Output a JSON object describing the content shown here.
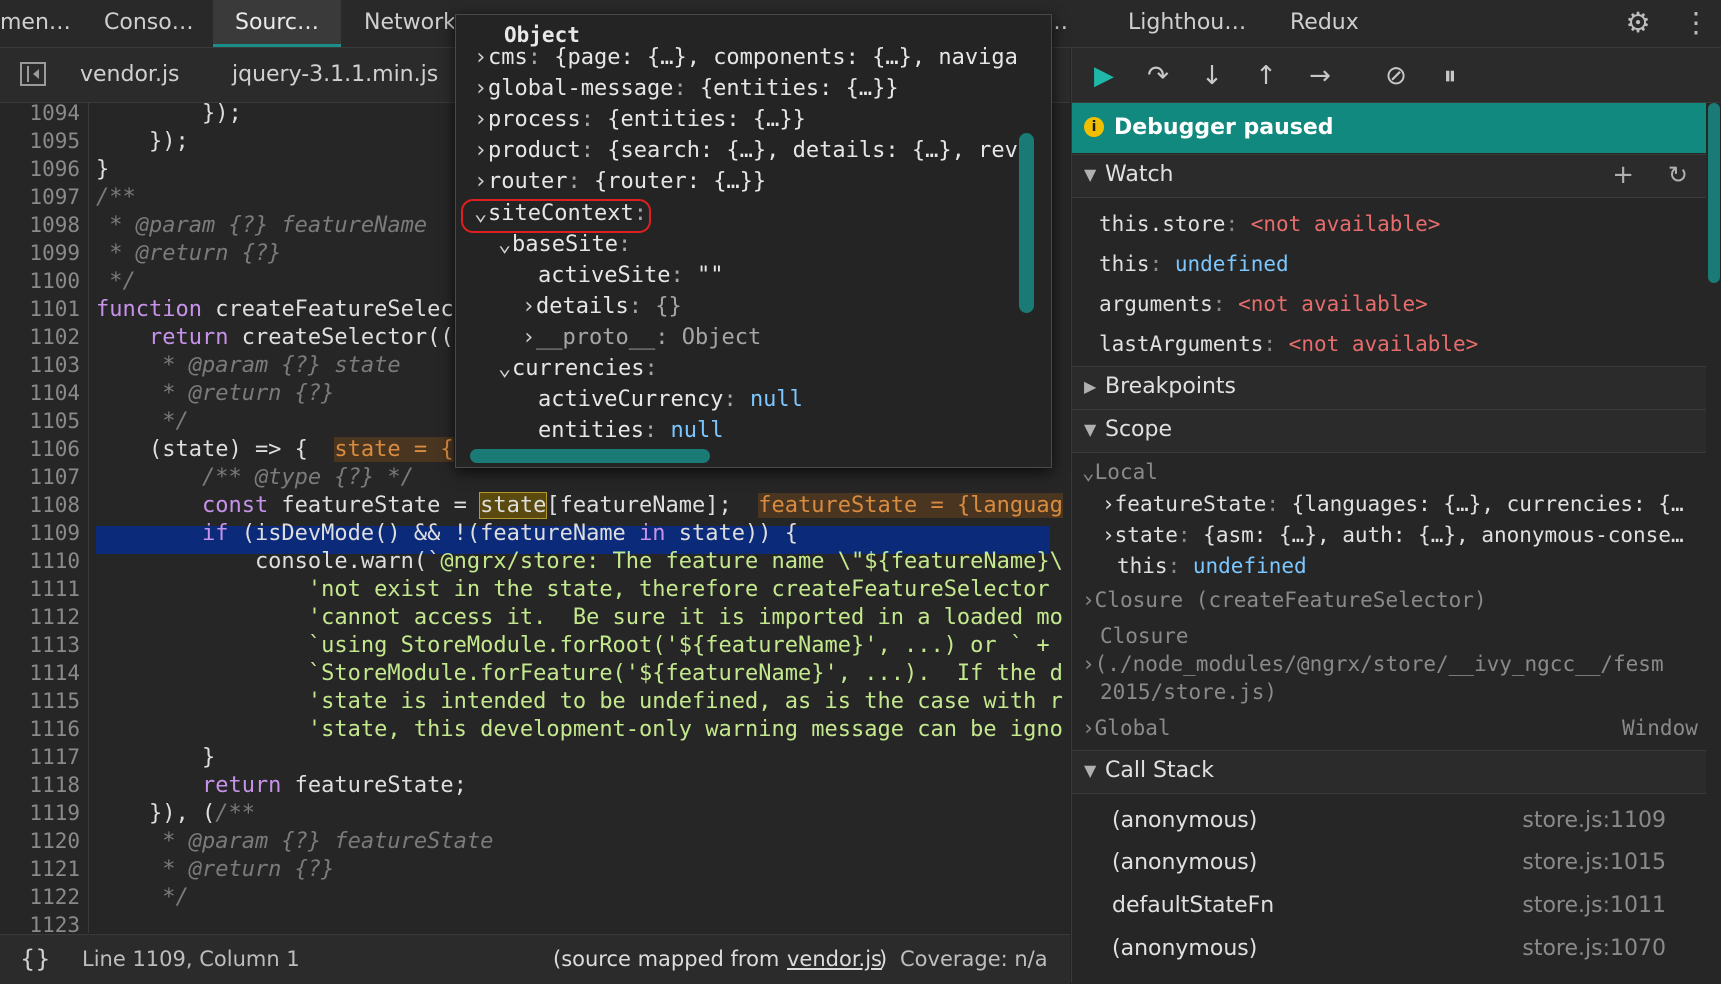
{
  "top_tabs": [
    "men…",
    "Conso…",
    "Sourc…",
    "Network",
    "…",
    "Lighthou…",
    "Redux"
  ],
  "file_tabs": [
    "vendor.js",
    "jquery-3.1.1.min.js"
  ],
  "code": {
    "line_numbers": [
      "1094",
      "1095",
      "1096",
      "1097",
      "1098",
      "1099",
      "1100",
      "1101",
      "1102",
      "1103",
      "1104",
      "1105",
      "1106",
      "1107",
      "1108",
      "1109",
      "1110",
      "1111",
      "1112",
      "1113",
      "1114",
      "1115",
      "1116",
      "1117",
      "1118",
      "1119",
      "1120",
      "1121",
      "1122",
      "1123"
    ],
    "l1094": "        });",
    "l1095": "    });",
    "l1096": "}",
    "l1097": "/**",
    "l1098": " * @param {?} featureName",
    "l1099": " * @return {?}",
    "l1100": " */",
    "l1101_kw": "function",
    "l1101": " createFeatureSelect",
    "l1102_kw": "    return",
    "l1102": " createSelector((",
    "l1103": "     * @param {?} state",
    "l1104": "     * @return {?}",
    "l1105": "     */",
    "l1106": "    (state) => {  ",
    "l1106_inline": "state = {",
    "l1107": "        /** @type {?} */",
    "l1108_kw": "        const",
    "l1108_a": " featureState = ",
    "l1108_state": "state",
    "l1108_b": "[featureName];  ",
    "l1108_inline": "featureState = {languag",
    "l1109_kw": "        if",
    "l1109": " (isDevMode() && !(featureName ",
    "l1109_in": "in",
    "l1109_b": " state)) {",
    "l1110_a": "            console.warn(`",
    "l1110_s": "@ngrx/store: The feature name \\\"${featureName}\\",
    "l1111": "                'not exist in the state, therefore createFeatureSelector",
    "l1112": "                'cannot access it.  Be sure it is imported in a loaded mo",
    "l1113": "                `using StoreModule.forRoot('${featureName}', ...) or ` +",
    "l1114": "                `StoreModule.forFeature('${featureName}', ...).  If the d",
    "l1115": "                'state is intended to be undefined, as is the case with r",
    "l1116": "                'state, this development-only warning message can be igno",
    "l1117": "        }",
    "l1118_kw": "        return",
    "l1118": " featureState;",
    "l1119": "    }), (",
    "l1119_c": "/**",
    "l1120": "     * @param {?} featureState",
    "l1121": "     * @return {?}",
    "l1122": "     */"
  },
  "status": {
    "position": "Line 1109, Column 1",
    "mapped_prefix": "(source mapped from ",
    "mapped_file": "vendor.js",
    "mapped_suffix": ")",
    "coverage": "Coverage: n/a"
  },
  "popover": {
    "title": "Object",
    "rows": [
      {
        "key": "cms",
        "value": "{page: {…}, components: {…}, naviga"
      },
      {
        "key": "global-message",
        "value": "{entities: {…}}"
      },
      {
        "key": "process",
        "value": "{entities: {…}}"
      },
      {
        "key": "product",
        "value": "{search: {…}, details: {…}, revi"
      },
      {
        "key": "router",
        "value": "{router: {…}}"
      },
      {
        "key": "siteContext",
        "value": ""
      },
      {
        "key": "baseSite",
        "value": ""
      },
      {
        "key": "activeSite",
        "value": "\"\""
      },
      {
        "key": "details",
        "value": "{}"
      },
      {
        "key": "__proto__",
        "value": "Object"
      },
      {
        "key": "currencies",
        "value": ""
      },
      {
        "key": "activeCurrency",
        "value": "null"
      },
      {
        "key": "entities",
        "value": "null"
      }
    ]
  },
  "debugger": {
    "paused_text": "Debugger paused",
    "watch_title": "Watch",
    "watch": [
      {
        "key": "this.store",
        "value": "<not available>"
      },
      {
        "key": "this",
        "value": "undefined"
      },
      {
        "key": "arguments",
        "value": "<not available>"
      },
      {
        "key": "lastArguments",
        "value": "<not available>"
      }
    ],
    "breakpoints_title": "Breakpoints",
    "scope_title": "Scope",
    "local_title": "Local",
    "local": [
      {
        "key": "featureState",
        "value": "{languages: {…}, currencies: {…"
      },
      {
        "key": "state",
        "value": "{asm: {…}, auth: {…}, anonymous-conse…"
      },
      {
        "key": "this",
        "value": "undefined"
      }
    ],
    "closure1": "Closure (createFeatureSelector)",
    "closure2_a": "Closure",
    "closure2_b": "(./node_modules/@ngrx/store/__ivy_ngcc__/fesm",
    "closure2_c": "2015/store.js)",
    "global": "Global",
    "global_value": "Window",
    "callstack_title": "Call Stack",
    "callstack": [
      {
        "name": "(anonymous)",
        "loc": "store.js:1109"
      },
      {
        "name": "(anonymous)",
        "loc": "store.js:1015"
      },
      {
        "name": "defaultStateFn",
        "loc": "store.js:1011"
      },
      {
        "name": "(anonymous)",
        "loc": "store.js:1070"
      }
    ]
  }
}
